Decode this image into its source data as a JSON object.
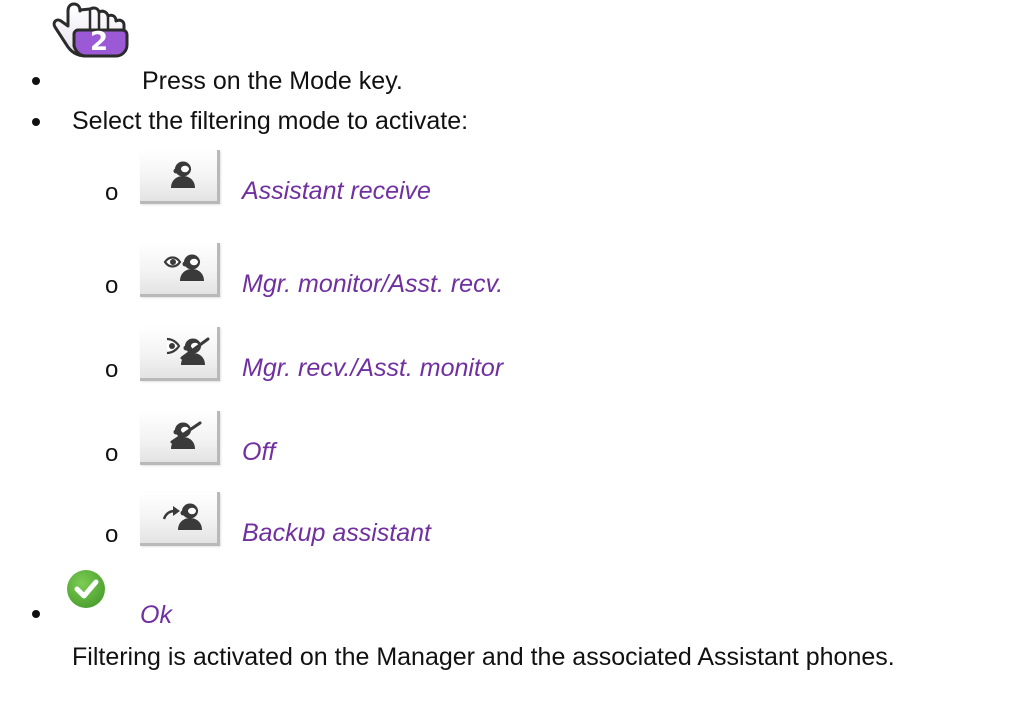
{
  "steps": [
    {
      "text": "Press on the Mode key.",
      "icon": "hand-pointer-2-icon",
      "badge": "2"
    },
    {
      "text": "Select the filtering mode to activate:"
    },
    {
      "text": "Ok",
      "icon": "ok-check-icon"
    },
    {
      "text": "Filtering is activated on the Manager and the associated Assistant phones."
    }
  ],
  "modes": [
    {
      "label": "Assistant receive",
      "icon": "assistant-receive-icon"
    },
    {
      "label": "Mgr. monitor/Asst. recv.",
      "icon": "manager-monitor-icon"
    },
    {
      "label": "Mgr. recv./Asst. monitor",
      "icon": "assistant-monitor-icon"
    },
    {
      "label": "Off",
      "icon": "filtering-off-icon"
    },
    {
      "label": "Backup assistant",
      "icon": "backup-assistant-icon"
    }
  ],
  "sub_bullet": "o",
  "colors": {
    "mode_text": "#7030a0",
    "ok_green": "#5db43b",
    "hand_purple": "#9b59d6"
  }
}
